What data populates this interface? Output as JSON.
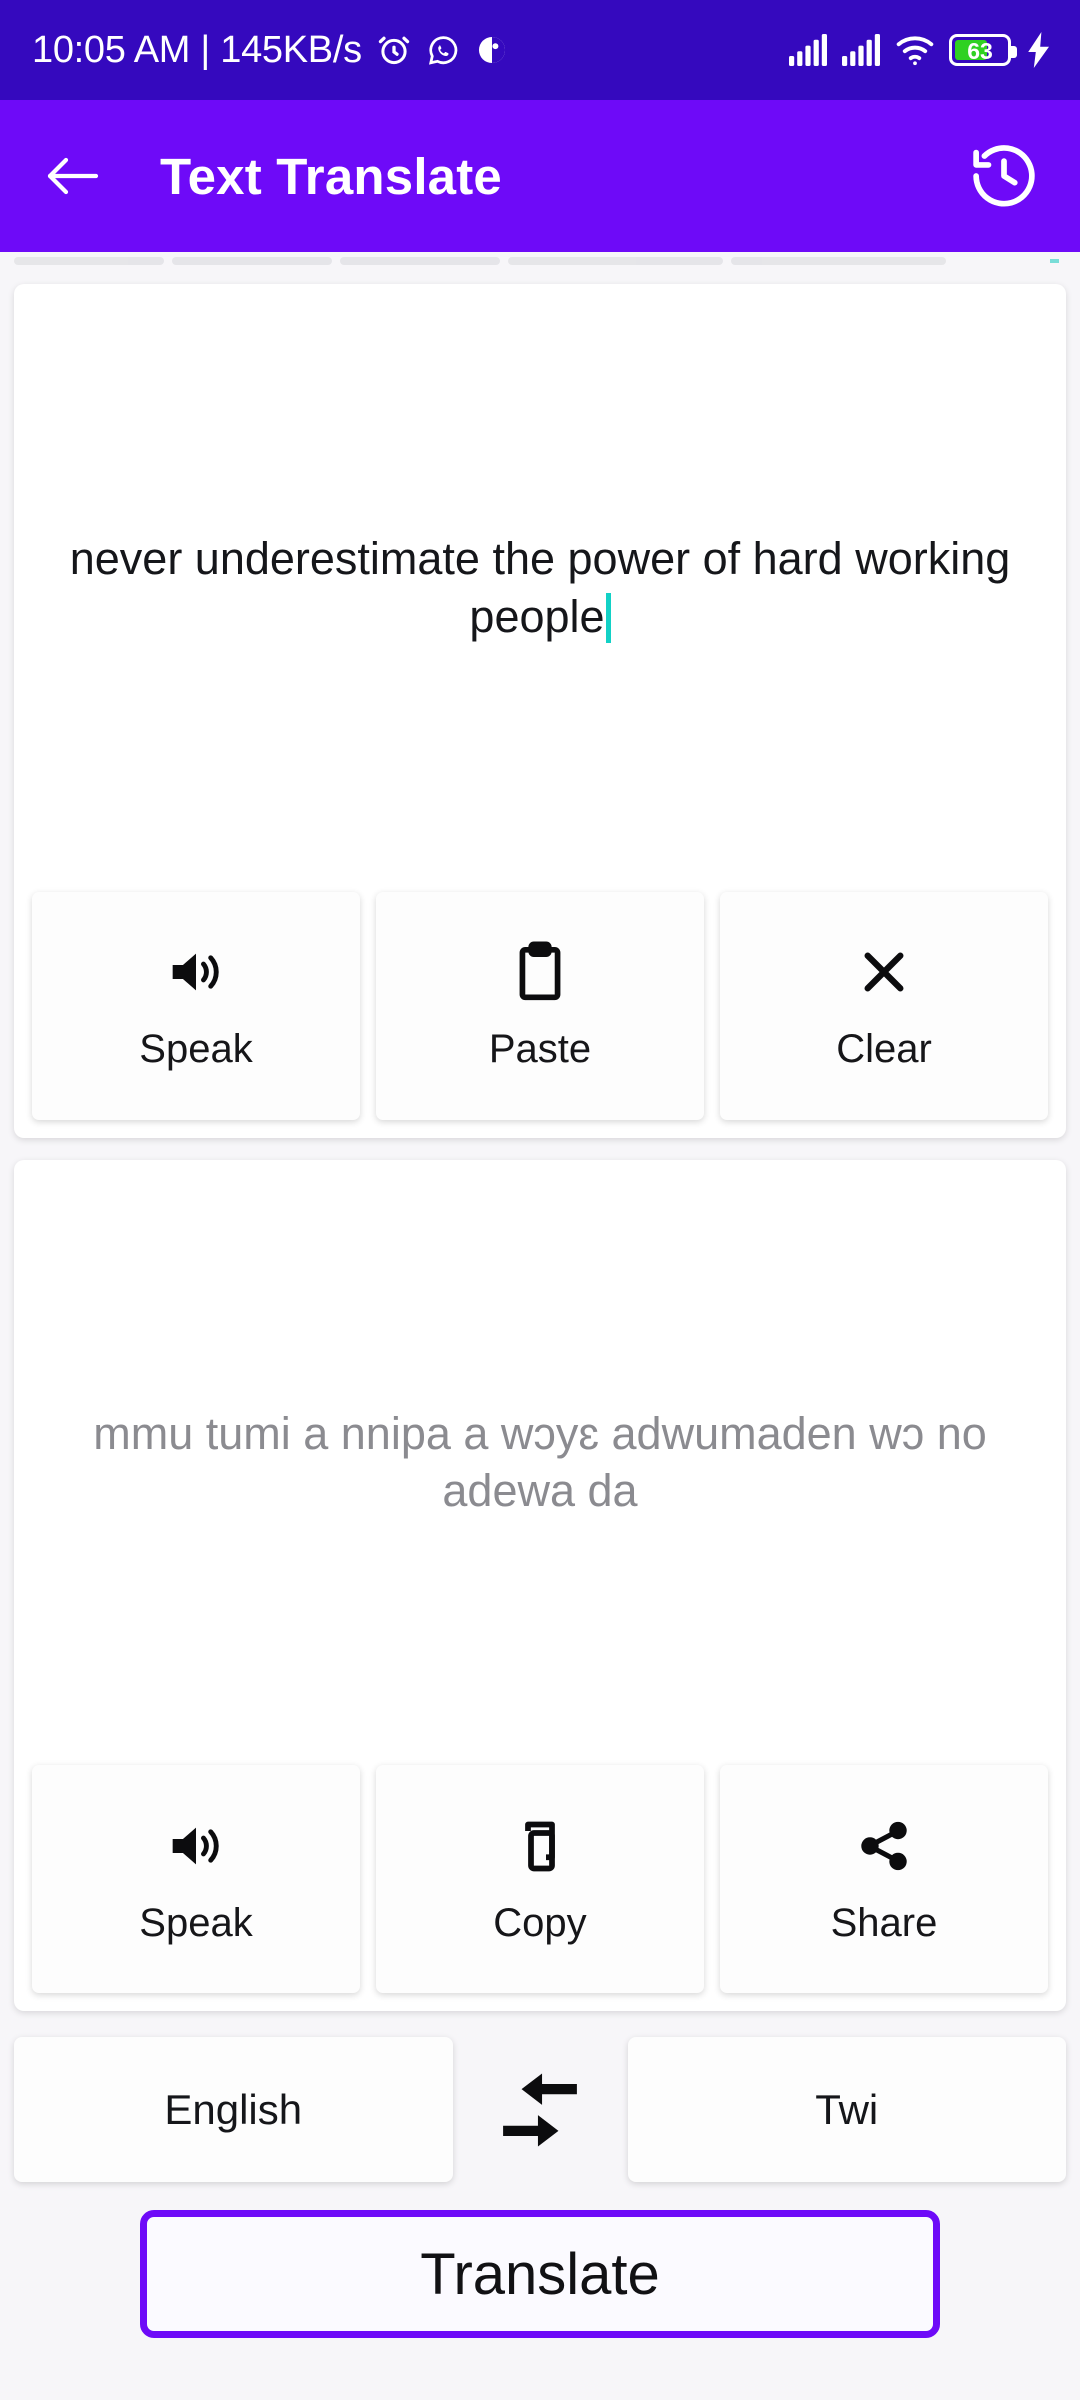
{
  "status_bar": {
    "clock": "10:05 AM | 145KB/s",
    "icons": [
      "alarm-icon",
      "whatsapp-icon",
      "app-notification-icon"
    ],
    "signal_icon": "signal-bars-icon",
    "signal_icon_2": "signal-bars-icon-2",
    "wifi_icon": "wifi-icon",
    "battery_level": "63",
    "battery_percent": 63,
    "charging_icon": "charging-bolt-icon",
    "background_color": "#3509be"
  },
  "app_bar": {
    "back_icon": "back-arrow-icon",
    "title": "Text Translate",
    "history_icon": "history-clock-icon",
    "background_color": "#6e0af8"
  },
  "input_card": {
    "text": "never underestimate the power of hard working people",
    "has_caret": true,
    "caret_color": "#12d1c6",
    "actions": [
      {
        "label": "Speak",
        "icon": "volume-up-icon"
      },
      {
        "label": "Paste",
        "icon": "clipboard-icon"
      },
      {
        "label": "Clear",
        "icon": "close-x-icon"
      }
    ]
  },
  "output_card": {
    "text": "mmu tumi a nnipa a wɔyɛ adwumaden wɔ no adewa da",
    "text_color": "#8b8b90",
    "actions": [
      {
        "label": "Speak",
        "icon": "volume-up-icon"
      },
      {
        "label": "Copy",
        "icon": "copy-pages-icon"
      },
      {
        "label": "Share",
        "icon": "share-nodes-icon"
      }
    ]
  },
  "language_bar": {
    "source_language": "English",
    "target_language": "Twi",
    "swap_icon": "swap-arrows-icon"
  },
  "translate_button": {
    "label": "Translate",
    "border_color": "#6e0af8"
  }
}
